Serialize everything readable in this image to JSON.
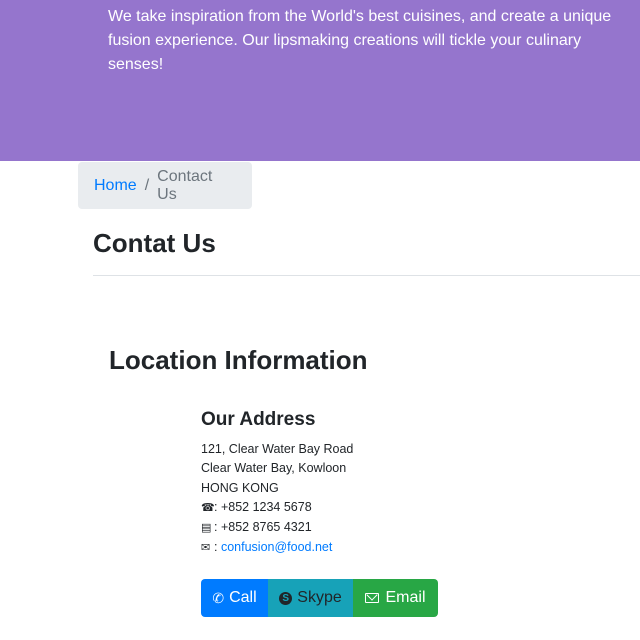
{
  "jumbotron": {
    "text": "We take inspiration from the World's best cuisines, and create a unique fusion experience. Our lipsmaking creations will tickle your culinary senses!"
  },
  "breadcrumb": {
    "home": "Home",
    "separator": "/",
    "active": "Contact Us"
  },
  "page_title": "Contat Us",
  "location": {
    "title": "Location Information",
    "address_title": "Our Address",
    "lines": [
      "121, Clear Water Bay Road",
      "Clear Water Bay, Kowloon",
      "HONG KONG"
    ],
    "phone": ": +852 1234 5678",
    "fax": ": +852 8765 4321",
    "email_prefix": ":",
    "email": "confusion@food.net",
    "icons": {
      "phone": "phone-icon",
      "fax": "fax-icon",
      "email": "envelope-icon"
    }
  },
  "buttons": {
    "call": "Call",
    "skype": "Skype",
    "email": "Email"
  },
  "colors": {
    "jumbotron": "#9575cd",
    "call": "#007bff",
    "skype": "#17a2b8",
    "email": "#28a745",
    "link": "#007bff"
  }
}
